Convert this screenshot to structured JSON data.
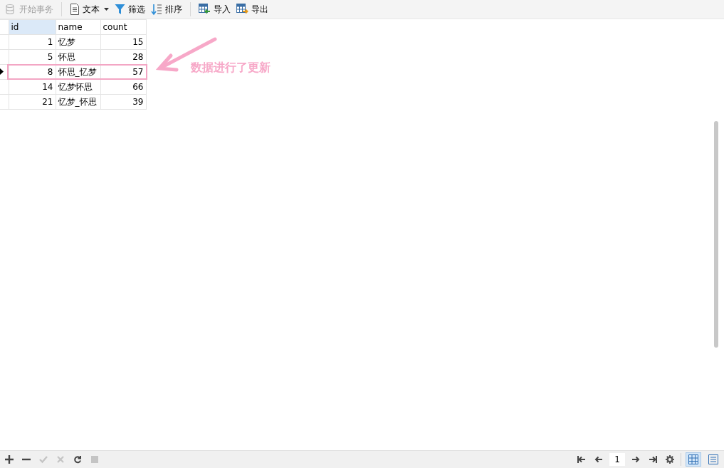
{
  "toolbar": {
    "groups": [
      [
        {
          "kind": "transaction",
          "label": "开始事务",
          "disabled": true,
          "dropdown": false
        }
      ],
      [
        {
          "kind": "text",
          "label": "文本",
          "disabled": false,
          "dropdown": true
        },
        {
          "kind": "filter",
          "label": "筛选",
          "disabled": false,
          "dropdown": false
        },
        {
          "kind": "sort",
          "label": "排序",
          "disabled": false,
          "dropdown": false
        }
      ],
      [
        {
          "kind": "import",
          "label": "导入",
          "disabled": false,
          "dropdown": false
        },
        {
          "kind": "export",
          "label": "导出",
          "disabled": false,
          "dropdown": false
        }
      ]
    ]
  },
  "table": {
    "columns": [
      {
        "label": "id",
        "selected": true
      },
      {
        "label": "name",
        "selected": false
      },
      {
        "label": "count",
        "selected": false
      }
    ],
    "rows": [
      {
        "id": "1",
        "name": "忆梦",
        "count": "15",
        "current": false,
        "highlighted": false
      },
      {
        "id": "5",
        "name": "怀思",
        "count": "28",
        "current": false,
        "highlighted": false
      },
      {
        "id": "8",
        "name": "怀思_忆梦",
        "count": "57",
        "current": true,
        "highlighted": true
      },
      {
        "id": "14",
        "name": "忆梦怀思",
        "count": "66",
        "current": false,
        "highlighted": false
      },
      {
        "id": "21",
        "name": "忆梦_怀思",
        "count": "39",
        "current": false,
        "highlighted": false
      }
    ]
  },
  "annotation": {
    "text": "数据进行了更新"
  },
  "record_actions": [
    {
      "kind": "add",
      "disabled": false
    },
    {
      "kind": "delete",
      "disabled": false
    },
    {
      "kind": "apply",
      "disabled": true
    },
    {
      "kind": "cancel",
      "disabled": true
    },
    {
      "kind": "refresh",
      "disabled": false
    },
    {
      "kind": "stop",
      "disabled": true
    }
  ],
  "pager": {
    "page": "1"
  },
  "views": [
    {
      "kind": "grid",
      "selected": true
    },
    {
      "kind": "form",
      "selected": false
    }
  ]
}
